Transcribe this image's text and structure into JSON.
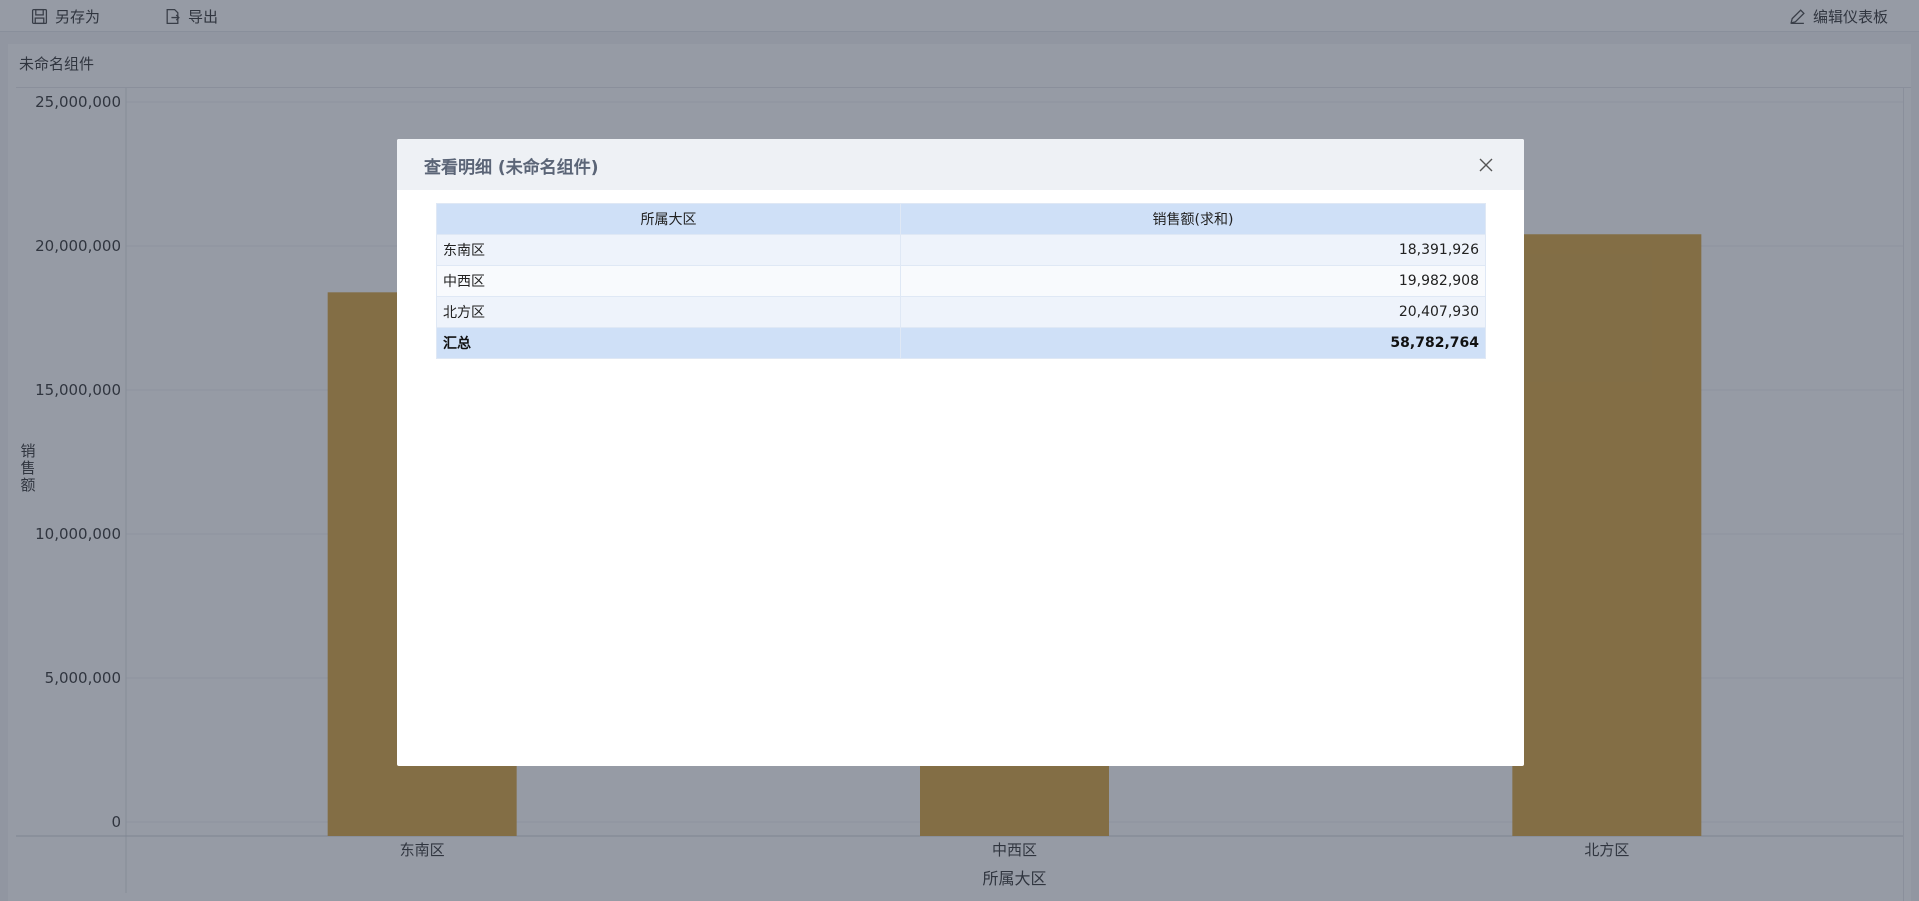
{
  "toolbar": {
    "save_as_label": "另存为",
    "export_label": "导出",
    "edit_dashboard_label": "编辑仪表板",
    "icons": [
      "save-icon",
      "export-icon",
      "edit-icon"
    ]
  },
  "widget": {
    "title": "未命名组件"
  },
  "chart_data": {
    "type": "bar",
    "categories": [
      "东南区",
      "中西区",
      "北方区"
    ],
    "values": [
      18391926,
      19982908,
      20407930
    ],
    "xlabel": "所属大区",
    "ylabel": "销售额",
    "ylim": [
      0,
      25000000
    ],
    "yticks": [
      0,
      5000000,
      10000000,
      15000000,
      20000000,
      25000000
    ],
    "ytick_labels": [
      "0",
      "5,000,000",
      "10,000,000",
      "15,000,000",
      "20,000,000",
      "25,000,000"
    ],
    "bar_color": "#d8a53f",
    "grid": true
  },
  "modal": {
    "title": "查看明细 (未命名组件)",
    "columns": [
      "所属大区",
      "销售额(求和)"
    ],
    "rows": [
      [
        "东南区",
        "18,391,926"
      ],
      [
        "中西区",
        "19,982,908"
      ],
      [
        "北方区",
        "20,407,930"
      ]
    ],
    "total": [
      "汇总",
      "58,782,764"
    ]
  },
  "colors": {
    "header_bg": "#cfe0f7",
    "mask": "rgba(45,56,76,0.5)",
    "modal_header_bg": "#eef1f5"
  }
}
